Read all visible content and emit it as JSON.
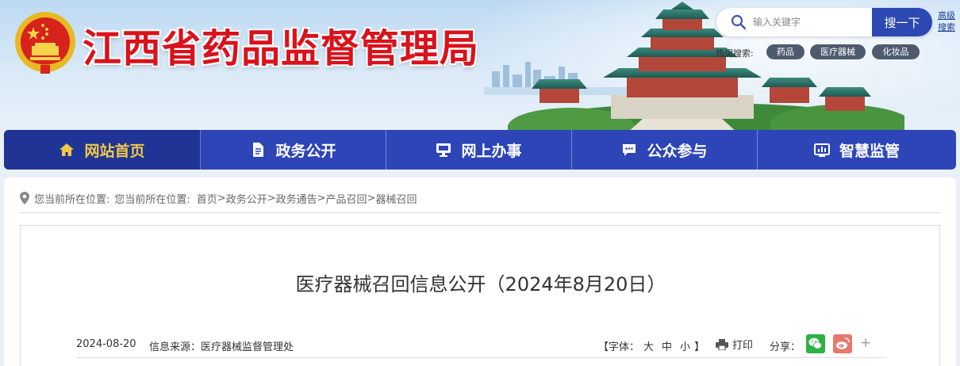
{
  "header": {
    "site_title": "江西省药品监督管理局",
    "search": {
      "placeholder": "输入关键字",
      "button_label": "搜一下",
      "advanced_label": "高级搜索"
    },
    "hot_search": {
      "label": "热词搜索:",
      "tags": [
        "药品",
        "医疗器械",
        "化妆品"
      ]
    }
  },
  "nav": {
    "items": [
      {
        "label": "网站首页",
        "icon": "home-icon",
        "active": true
      },
      {
        "label": "政务公开",
        "icon": "document-icon",
        "active": false
      },
      {
        "label": "网上办事",
        "icon": "monitor-icon",
        "active": false
      },
      {
        "label": "公众参与",
        "icon": "chat-icon",
        "active": false
      },
      {
        "label": "智慧监管",
        "icon": "dashboard-icon",
        "active": false
      }
    ]
  },
  "breadcrumb": {
    "prefix": "您当前所在位置:",
    "prefix2": "您当前所在位置:",
    "items": [
      "首页",
      "政务公开",
      "政务通告",
      "产品召回",
      "器械召回"
    ],
    "separator": ">"
  },
  "article": {
    "title": "医疗器械召回信息公开（2024年8月20日）",
    "date": "2024-08-20",
    "source": "信息来源：医疗器械监督管理处",
    "font_size": {
      "open": "【字体：",
      "large": "大",
      "medium": "中",
      "small": "小",
      "close": "】"
    },
    "print_label": "打印",
    "share_label": "分享：",
    "share_more": "+"
  },
  "colors": {
    "title_red": "#d9121b",
    "nav_blue": "#2e45b8",
    "nav_active_text": "#f2c84b",
    "search_button": "#2c49b3",
    "wechat_green": "#2cb244",
    "weibo_red": "#e8786a"
  }
}
